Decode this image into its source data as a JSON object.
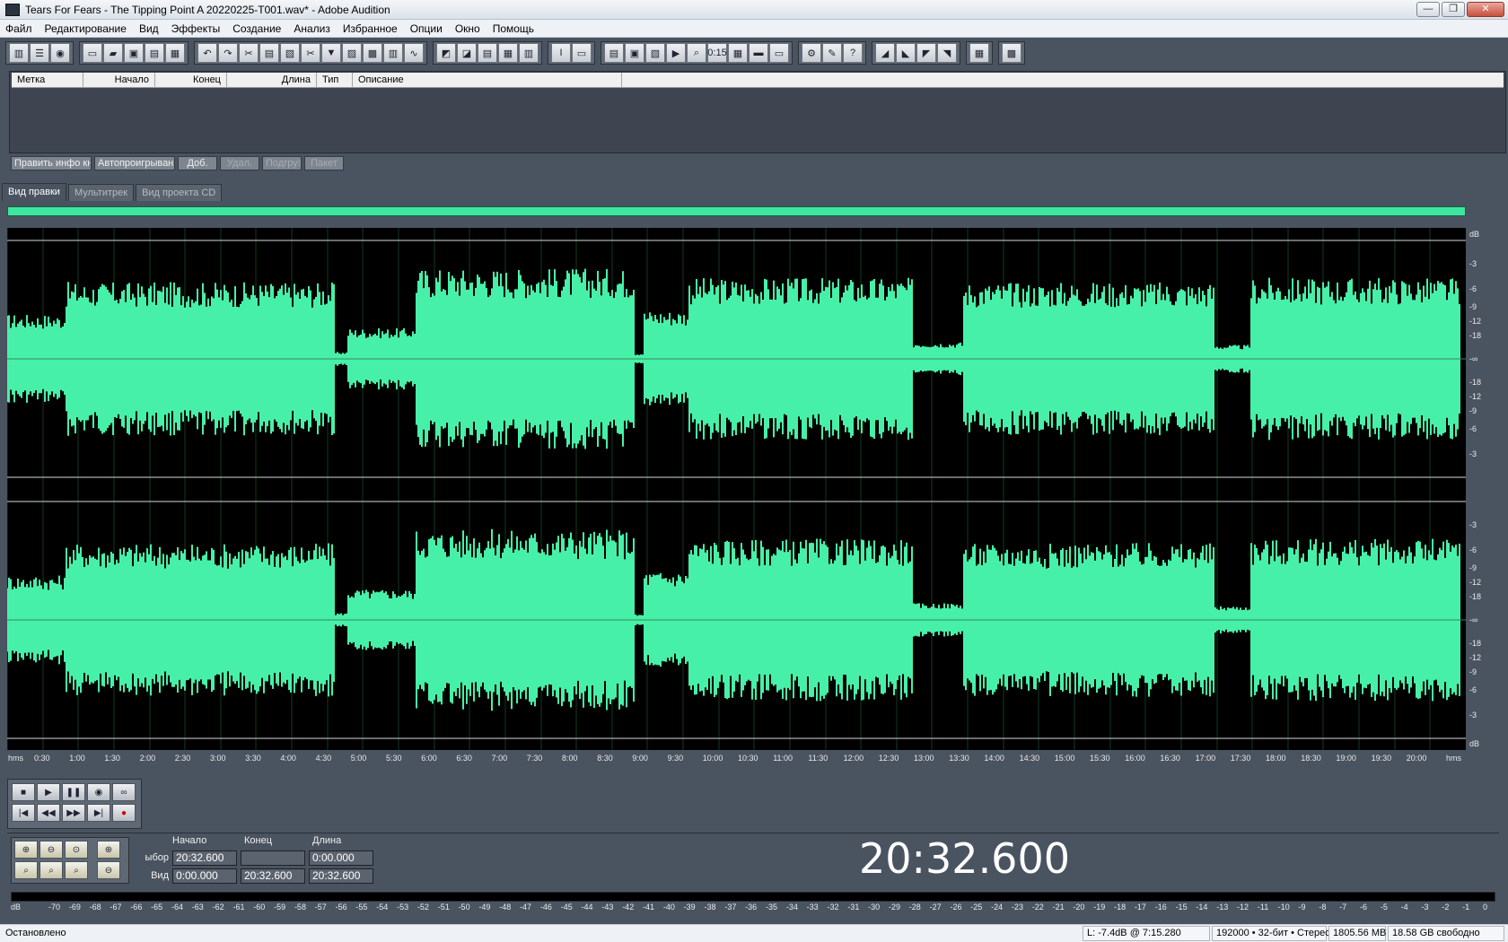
{
  "window": {
    "title": "Tears For Fears - The Tipping Point  A 20220225-T001.wav* - Adobe Audition",
    "minimize": "—",
    "restore": "❐",
    "close": "✕"
  },
  "menu": [
    "Файл",
    "Редактирование",
    "Вид",
    "Эффекты",
    "Создание",
    "Анализ",
    "Избранное",
    "Опции",
    "Окно",
    "Помощь"
  ],
  "marker_list": {
    "columns": [
      "Метка",
      "Начало",
      "Конец",
      "Длина",
      "Тип",
      "Описание"
    ],
    "buttons": [
      {
        "label": "Править инфо кна",
        "enabled": true
      },
      {
        "label": "Автопроигрывани",
        "enabled": true
      },
      {
        "label": "Доб.",
        "enabled": true
      },
      {
        "label": "Удал.",
        "enabled": false
      },
      {
        "label": "Подгруз",
        "enabled": false
      },
      {
        "label": "Пакет",
        "enabled": false
      }
    ]
  },
  "view_tabs": [
    {
      "label": "Вид правки",
      "active": true
    },
    {
      "label": "Мультитрек",
      "active": false
    },
    {
      "label": "Вид проекта CD",
      "active": false
    }
  ],
  "waveform": {
    "color": "#47f0a8",
    "db_label": "dB",
    "db_ticks_top": [
      "-3",
      "-6",
      "-9",
      "-12",
      "-18",
      "-∞",
      "-18",
      "-12",
      "-9",
      "-6",
      "-3"
    ],
    "db_ticks_bottom": [
      "-3",
      "-6",
      "-9",
      "-12",
      "-18",
      "-∞",
      "-18",
      "-12",
      "-9",
      "-6",
      "-3"
    ]
  },
  "time_ruler": {
    "unit": "hms",
    "labels": [
      "0:30",
      "1:00",
      "1:30",
      "2:00",
      "2:30",
      "3:00",
      "3:30",
      "4:00",
      "4:30",
      "5:00",
      "5:30",
      "6:00",
      "6:30",
      "7:00",
      "7:30",
      "8:00",
      "8:30",
      "9:00",
      "9:30",
      "10:00",
      "10:30",
      "11:00",
      "11:30",
      "12:00",
      "12:30",
      "13:00",
      "13:30",
      "14:00",
      "14:30",
      "15:00",
      "15:30",
      "16:00",
      "16:30",
      "17:00",
      "17:30",
      "18:00",
      "18:30",
      "19:00",
      "19:30",
      "20:00"
    ]
  },
  "selection": {
    "header_start": "Начало",
    "header_end": "Конец",
    "header_length": "Длина",
    "sel_label": "ыбор",
    "view_label": "Вид",
    "sel_start": "20:32.600",
    "sel_end": "",
    "sel_length": "0:00.000",
    "view_start": "0:00.000",
    "view_end": "20:32.600",
    "view_length": "20:32.600"
  },
  "big_time": "20:32.600",
  "meter": {
    "label": "dB",
    "ticks": [
      "-70",
      "-69",
      "-68",
      "-67",
      "-66",
      "-65",
      "-64",
      "-63",
      "-62",
      "-61",
      "-60",
      "-59",
      "-58",
      "-57",
      "-56",
      "-55",
      "-54",
      "-53",
      "-52",
      "-51",
      "-50",
      "-49",
      "-48",
      "-47",
      "-46",
      "-45",
      "-44",
      "-43",
      "-42",
      "-41",
      "-40",
      "-39",
      "-38",
      "-37",
      "-36",
      "-35",
      "-34",
      "-33",
      "-32",
      "-31",
      "-30",
      "-29",
      "-28",
      "-27",
      "-26",
      "-25",
      "-24",
      "-23",
      "-22",
      "-21",
      "-20",
      "-19",
      "-18",
      "-17",
      "-16",
      "-15",
      "-14",
      "-13",
      "-12",
      "-11",
      "-10",
      "-9",
      "-8",
      "-7",
      "-6",
      "-5",
      "-4",
      "-3",
      "-2",
      "-1",
      "0"
    ]
  },
  "status": {
    "state": "Остановлено",
    "cursor": "L: -7.4dB @   7:15.280",
    "format": "192000 • 32-бит • Стерео",
    "size": "1805.56 MB",
    "free": "18.58 GB свободно"
  }
}
